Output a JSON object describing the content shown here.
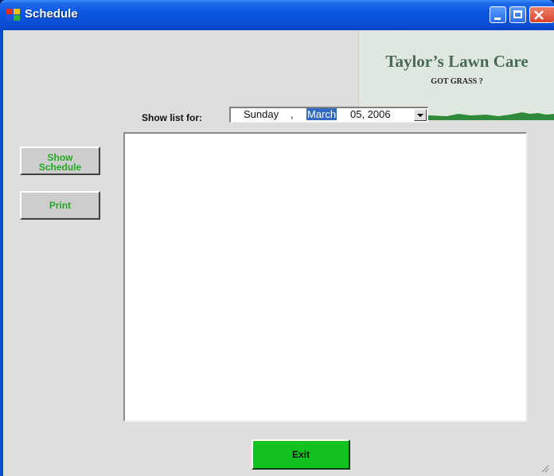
{
  "window": {
    "title": "Schedule",
    "icons": {
      "app": "app-icon",
      "minimize": "minimize-icon",
      "maximize": "maximize-icon",
      "close": "close-icon"
    },
    "colors": {
      "titlebar": "#0b4fd6",
      "client": "#dedede",
      "accent_green": "#12c21e",
      "button_text_green": "#22aa22"
    }
  },
  "banner": {
    "title": "Taylor’s Lawn Care",
    "subtitle": "GOT GRASS ?"
  },
  "filter": {
    "label": "Show list for:",
    "date": {
      "weekday": "Sunday",
      "separator": ",",
      "month": "March",
      "day_year": "05, 2006"
    }
  },
  "sidebar": {
    "show_schedule_label": "Show Schedule",
    "print_label": "Print"
  },
  "list": {
    "items": []
  },
  "footer": {
    "exit_label": "Exit"
  }
}
